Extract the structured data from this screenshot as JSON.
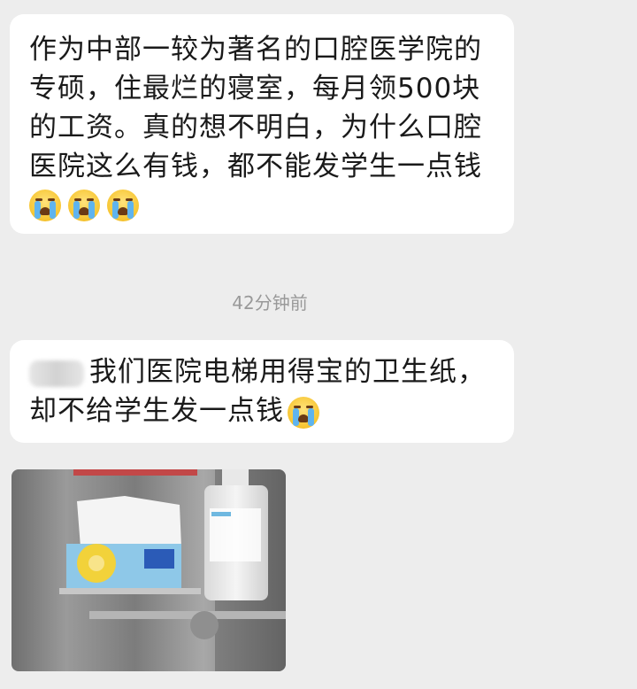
{
  "messages": [
    {
      "lines": [
        "作为中部一较为著名的口腔医学院的",
        "专硕，住最烂的寝室，每月领500块",
        "的工资。真的想不明白，为什么口腔",
        "医院这么有钱，都不能发学生一点钱"
      ],
      "emojis": [
        "crying-face",
        "crying-face",
        "crying-face"
      ]
    },
    {
      "lines": [
        "我们医院电梯用得宝的卫生纸，",
        "却不给学生发一点钱"
      ],
      "emojis": [
        "crying-face"
      ]
    }
  ],
  "timestamp": "42分钟前",
  "colors": {
    "background": "#ededed",
    "bubble": "#ffffff",
    "text": "#1a1a1a",
    "timestamp": "#999999"
  }
}
